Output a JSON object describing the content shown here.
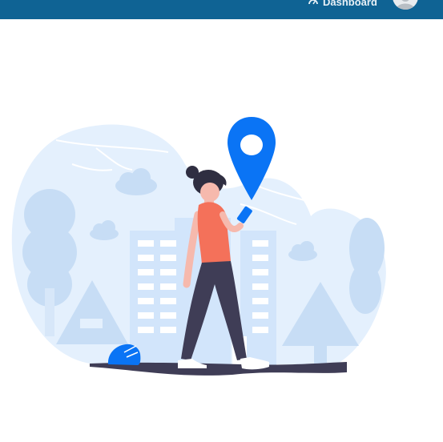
{
  "header": {
    "dashboard_label": "Dashboard",
    "dashboard_icon": "gauge-icon",
    "avatar_icon": "user-avatar-icon",
    "bar_color": "#0f6394"
  },
  "hero": {
    "illustration": "woman-walking-with-phone-location-pin",
    "pin_color": "#0a74f5",
    "shirt_color": "#f4715a",
    "bg_color": "#e4f0fd"
  }
}
